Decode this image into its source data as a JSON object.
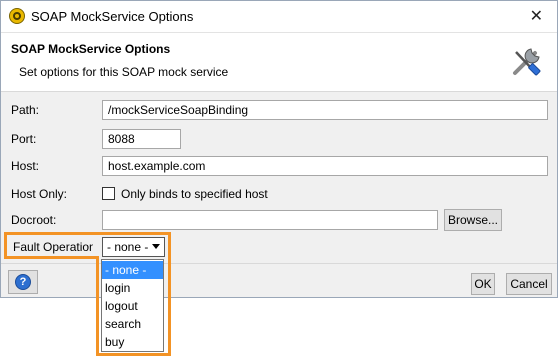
{
  "window": {
    "title": "SOAP MockService Options",
    "close_glyph": "✕"
  },
  "header": {
    "title": "SOAP MockService Options",
    "subtitle": "Set options for this SOAP mock service",
    "icon": "tools-icon"
  },
  "form": {
    "path": {
      "label": "Path:",
      "value": "/mockServiceSoapBinding"
    },
    "port": {
      "label": "Port:",
      "value": "8088"
    },
    "host": {
      "label": "Host:",
      "value": "host.example.com"
    },
    "host_only": {
      "label": "Host Only:",
      "checkbox_label": "Only binds to specified host",
      "checked": false
    },
    "docroot": {
      "label": "Docroot:",
      "value": "",
      "browse_label": "Browse..."
    },
    "fault_operation": {
      "label": "Fault Operation:",
      "selected": "- none -",
      "options": [
        "- none -",
        "login",
        "logout",
        "search",
        "buy"
      ]
    }
  },
  "footer": {
    "ok_label": "OK",
    "cancel_label": "Cancel",
    "help_glyph": "?"
  },
  "colors": {
    "highlight": "#f39325",
    "selection": "#3390ff",
    "help_blue": "#2d6fd0"
  }
}
